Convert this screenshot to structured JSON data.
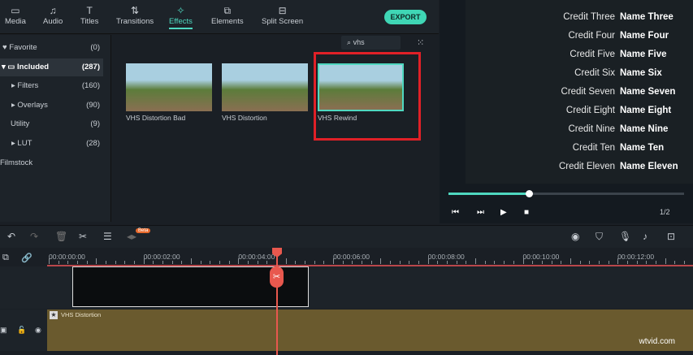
{
  "tabs": [
    {
      "label": "Media",
      "icon": "folder-icon"
    },
    {
      "label": "Audio",
      "icon": "music-icon"
    },
    {
      "label": "Titles",
      "icon": "text-icon"
    },
    {
      "label": "Transitions",
      "icon": "transition-icon"
    },
    {
      "label": "Effects",
      "icon": "effects-icon",
      "active": true
    },
    {
      "label": "Elements",
      "icon": "elements-icon"
    },
    {
      "label": "Split Screen",
      "icon": "split-screen-icon"
    }
  ],
  "export_label": "EXPORT",
  "sidebar": [
    {
      "label": "Favorite",
      "count": "(0)"
    },
    {
      "label": "Included",
      "count": "(287)"
    },
    {
      "label": "Filters",
      "count": "(160)"
    },
    {
      "label": "Overlays",
      "count": "(90)"
    },
    {
      "label": "Utility",
      "count": "(9)"
    },
    {
      "label": "LUT",
      "count": "(28)"
    },
    {
      "label": "Filmstock",
      "count": ""
    }
  ],
  "search_value": "vhs",
  "effects": [
    {
      "label": "VHS Distortion Bad"
    },
    {
      "label": "VHS Distortion"
    },
    {
      "label": "VHS Rewind",
      "selected": true
    }
  ],
  "credits": [
    [
      "Credit Three",
      "Name Three"
    ],
    [
      "Credit Four",
      "Name Four"
    ],
    [
      "Credit Five",
      "Name Five"
    ],
    [
      "Credit Six",
      "Name Six"
    ],
    [
      "Credit Seven",
      "Name Seven"
    ],
    [
      "Credit Eight",
      "Name Eight"
    ],
    [
      "Credit Nine",
      "Name Nine"
    ],
    [
      "Credit Ten",
      "Name Ten"
    ],
    [
      "Credit Eleven",
      "Name Eleven"
    ]
  ],
  "playback_progress": 0.34,
  "page_ratio": "1/2",
  "beta_label": "Beta",
  "ruler": [
    "00:00:00:00",
    "00:00:02:00",
    "00:00:04:00",
    "00:00:06:00",
    "00:00:08:00",
    "00:00:10:00",
    "00:00:12:00"
  ],
  "track_clip_label": "VHS Distortion",
  "watermark": "wtvid.com",
  "colors": {
    "accent": "#4fd8c0",
    "highlight": "#e02027",
    "playhead": "#e8584e",
    "effect_track": "#6a5a2e"
  }
}
